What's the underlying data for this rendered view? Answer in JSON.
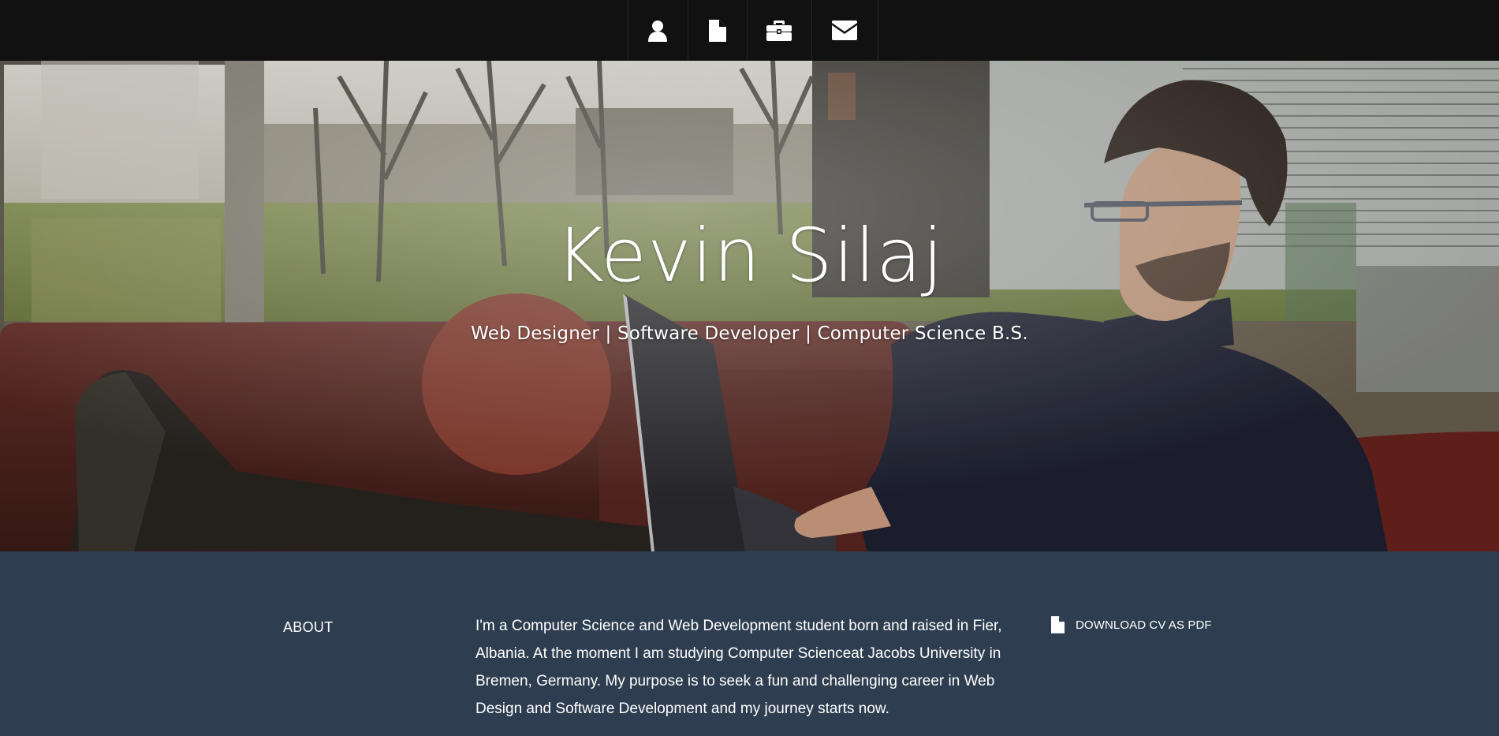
{
  "nav": {
    "items": [
      {
        "name": "profile",
        "icon": "user-icon"
      },
      {
        "name": "resume",
        "icon": "document-icon"
      },
      {
        "name": "portfolio",
        "icon": "briefcase-icon"
      },
      {
        "name": "contact",
        "icon": "envelope-icon"
      }
    ]
  },
  "hero": {
    "title": "Kevin Silaj",
    "subtitle": "Web Designer | Software Developer | Computer Science B.S."
  },
  "about": {
    "heading": "ABOUT",
    "text": "I'm a Computer Science and Web Development student born and raised in Fier, Albania. At the moment I am studying Computer Scienceat Jacobs University in Bremen, Germany. My purpose is to seek a fun and challenging career in Web Design and Software Development and my journey starts now.",
    "download_label": "DOWNLOAD CV AS PDF",
    "download_icon": "document-icon"
  },
  "colors": {
    "nav_bg": "#111111",
    "about_bg": "#2e3e50",
    "text": "#ffffff"
  }
}
